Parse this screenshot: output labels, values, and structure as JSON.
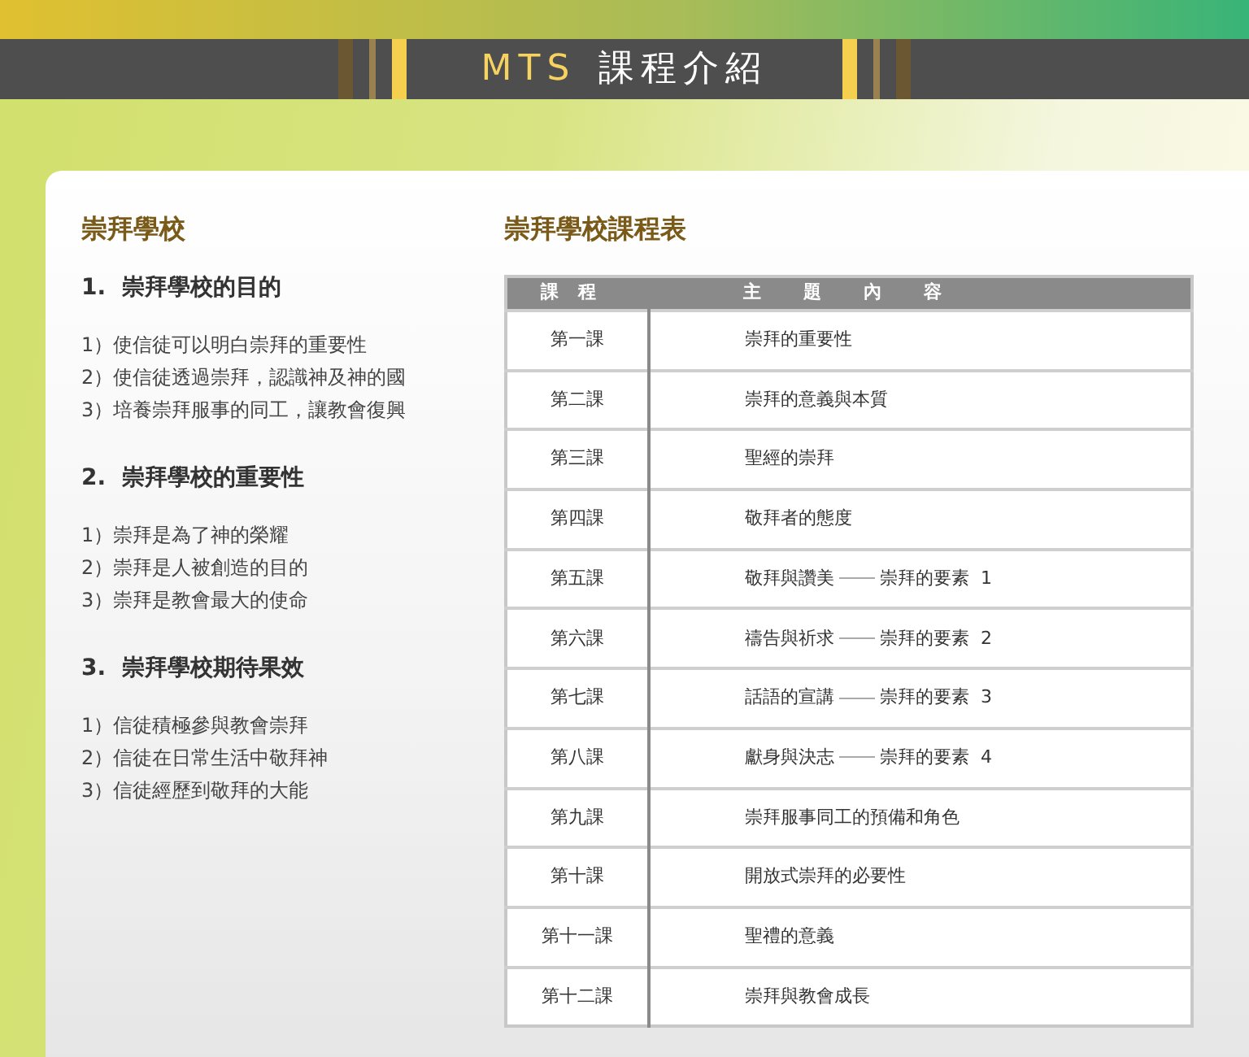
{
  "banner": {
    "title_latin": "MTS",
    "title_cjk": "課程介紹"
  },
  "school": {
    "title": "崇拜學校",
    "sections": [
      {
        "heading": "1.  崇拜學校的目的",
        "items": [
          "1）使信徒可以明白崇拜的重要性",
          "2）使信徒透過崇拜，認識神及神的國",
          "3）培養崇拜服事的同工，讓教會復興"
        ]
      },
      {
        "heading": "2.  崇拜學校的重要性",
        "items": [
          "1）崇拜是為了神的榮耀",
          "2）崇拜是人被創造的目的",
          "3）崇拜是教會最大的使命"
        ]
      },
      {
        "heading": "3.  崇拜學校期待果效",
        "items": [
          "1）信徒積極參與教會崇拜",
          "2）信徒在日常生活中敬拜神",
          "3）信徒經歷到敬拜的大能"
        ]
      }
    ]
  },
  "schedule": {
    "title": "崇拜學校課程表",
    "columns": [
      "課程",
      "主題內容"
    ],
    "rows": [
      {
        "lesson": "第一課",
        "topic": "崇拜的重要性"
      },
      {
        "lesson": "第二課",
        "topic": "崇拜的意義與本質"
      },
      {
        "lesson": "第三課",
        "topic": "聖經的崇拜"
      },
      {
        "lesson": "第四課",
        "topic": "敬拜者的態度"
      },
      {
        "lesson": "第五課",
        "topic": "敬拜與讚美",
        "element": "崇拜的要素  1"
      },
      {
        "lesson": "第六課",
        "topic": "禱告與祈求",
        "element": "崇拜的要素  2"
      },
      {
        "lesson": "第七課",
        "topic": "話語的宣講",
        "element": "崇拜的要素  3"
      },
      {
        "lesson": "第八課",
        "topic": "獻身與決志",
        "element": "崇拜的要素  4"
      },
      {
        "lesson": "第九課",
        "topic": "崇拜服事同工的預備和角色"
      },
      {
        "lesson": "第十課",
        "topic": "開放式崇拜的必要性"
      },
      {
        "lesson": "第十一課",
        "topic": "聖禮的意義"
      },
      {
        "lesson": "第十二課",
        "topic": "崇拜與教會成長"
      }
    ]
  }
}
